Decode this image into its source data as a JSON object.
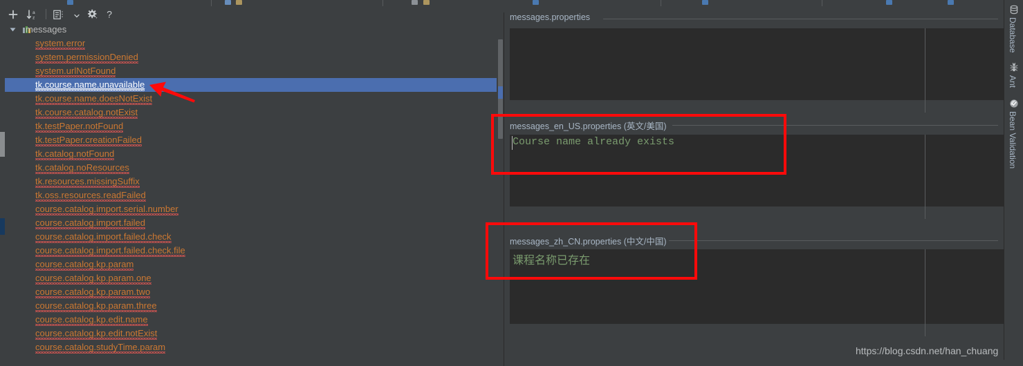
{
  "window": {
    "theme_bg": "#3c3f41",
    "editor_bg": "#2b2b2b",
    "accent_selection": "#4b6eaf",
    "key_color": "#cc7832",
    "value_color": "#7a9b6e",
    "annotation_color": "#ff0a0a"
  },
  "toolbar": {
    "buttons": [
      {
        "name": "add-property-button",
        "icon": "plus-icon",
        "label": "+"
      },
      {
        "name": "sort-alphabetically-button",
        "icon": "sort-az-icon",
        "label": "↓az"
      },
      {
        "name": "group-by-button",
        "icon": "tree-list-icon",
        "label": "group"
      },
      {
        "name": "group-dropdown-button",
        "icon": "chevron-down-icon",
        "label": "▾"
      },
      {
        "name": "settings-button",
        "icon": "gear-icon",
        "label": "⚙"
      },
      {
        "name": "help-button",
        "icon": "question-mark-icon",
        "label": "?"
      }
    ]
  },
  "tree": {
    "root": {
      "label": "messages",
      "icon": "resource-bundle-icon",
      "expanded": true
    },
    "items": [
      {
        "label": "system.error",
        "selected": false,
        "has_warning": true
      },
      {
        "label": "system.permissionDenied",
        "selected": false,
        "has_warning": true
      },
      {
        "label": "system.urlNotFound",
        "selected": false,
        "has_warning": true
      },
      {
        "label": "tk.course.name.unavailable",
        "selected": true,
        "has_warning": true
      },
      {
        "label": "tk.course.name.doesNotExist",
        "selected": false,
        "has_warning": true
      },
      {
        "label": "tk.course.catalog.notExist",
        "selected": false,
        "has_warning": true
      },
      {
        "label": "tk.testPaper.notFound",
        "selected": false,
        "has_warning": true
      },
      {
        "label": "tk.testPaper.creationFailed",
        "selected": false,
        "has_warning": true
      },
      {
        "label": "tk.catalog.notFound",
        "selected": false,
        "has_warning": true
      },
      {
        "label": "tk.catalog.noResources",
        "selected": false,
        "has_warning": true
      },
      {
        "label": "tk.resources.missingSuffix",
        "selected": false,
        "has_warning": true
      },
      {
        "label": "tk.oss.resources.readFailed",
        "selected": false,
        "has_warning": true
      },
      {
        "label": "course.catalog.import.serial.number",
        "selected": false,
        "has_warning": true
      },
      {
        "label": "course.catalog.import.failed",
        "selected": false,
        "has_warning": true
      },
      {
        "label": "course.catalog.import.failed.check",
        "selected": false,
        "has_warning": true
      },
      {
        "label": "course.catalog.import.failed.check.file",
        "selected": false,
        "has_warning": true
      },
      {
        "label": "course.catalog.kp.param",
        "selected": false,
        "has_warning": true
      },
      {
        "label": "course.catalog.kp.param.one",
        "selected": false,
        "has_warning": true
      },
      {
        "label": "course.catalog.kp.param.two",
        "selected": false,
        "has_warning": true
      },
      {
        "label": "course.catalog.kp.param.three",
        "selected": false,
        "has_warning": true
      },
      {
        "label": "course.catalog.kp.edit.name",
        "selected": false,
        "has_warning": true
      },
      {
        "label": "course.catalog.kp.edit.notExist",
        "selected": false,
        "has_warning": true
      },
      {
        "label": "course.catalog.studyTime.param",
        "selected": false,
        "has_warning": true
      }
    ]
  },
  "editors": [
    {
      "name": "messages-properties-editor",
      "title": "messages.properties",
      "locale": "",
      "value": "",
      "annotated": false
    },
    {
      "name": "messages-en-us-properties-editor",
      "title": "messages_en_US.properties",
      "locale": "(英文/美国)",
      "value": "Course name already exists",
      "annotated": true
    },
    {
      "name": "messages-zh-cn-properties-editor",
      "title": "messages_zh_CN.properties",
      "locale": "(中文/中国)",
      "value": "课程名称已存在",
      "annotated": true
    }
  ],
  "right_tool_tabs": [
    {
      "label": "Database",
      "icon": "database-icon"
    },
    {
      "label": "Ant",
      "icon": "ant-icon"
    },
    {
      "label": "Bean Validation",
      "icon": "bean-validation-icon"
    }
  ],
  "watermark": {
    "text": "https://blog.csdn.net/han_chuang"
  }
}
